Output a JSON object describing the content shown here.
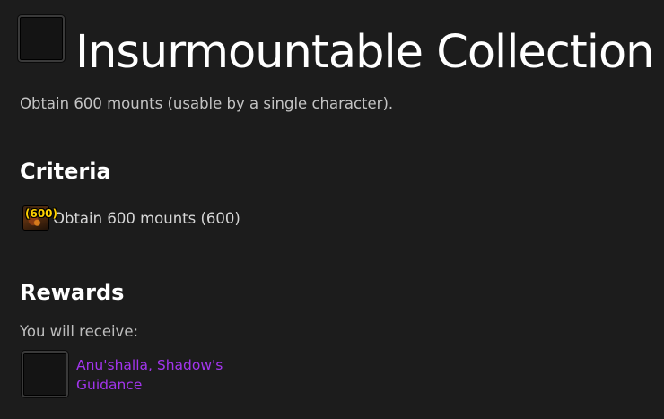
{
  "achievement": {
    "icon": "achievement-icon-placeholder",
    "title": "Insurmountable Collection",
    "description": "Obtain 600 mounts (usable by a single character)."
  },
  "criteria": {
    "heading": "Criteria",
    "items": [
      {
        "icon": "mount-icon",
        "icon_count": "(600)",
        "text": "Obtain 600 mounts (600)"
      }
    ]
  },
  "rewards": {
    "heading": "Rewards",
    "subtext": "You will receive:",
    "items": [
      {
        "icon": "reward-item-icon-placeholder",
        "name": "Anu'shalla, Shadow's Guidance",
        "quality_color": "#a335ee"
      }
    ]
  },
  "colors": {
    "background": "#1c1c1c",
    "heading": "#ffffff",
    "text": "#c9c9c9",
    "epic": "#a335ee",
    "count_badge": "#ffd100"
  }
}
